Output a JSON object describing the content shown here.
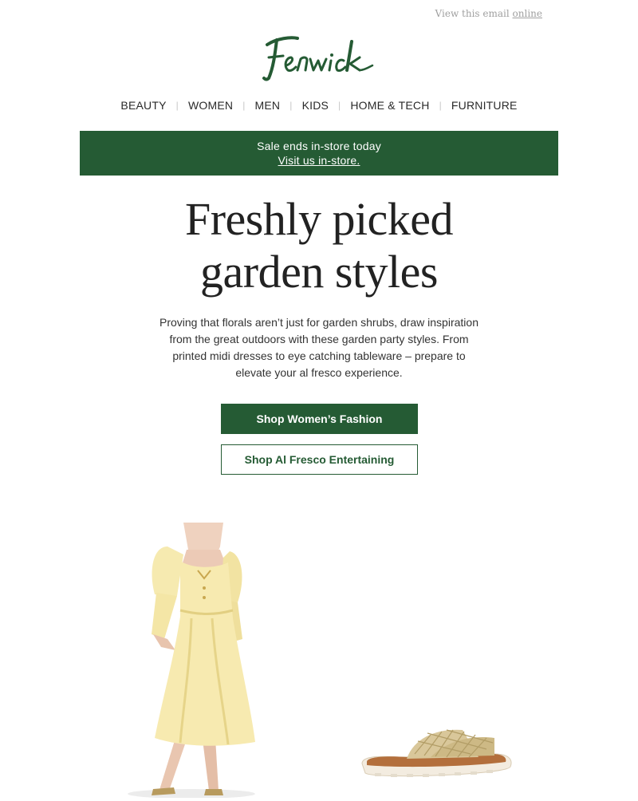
{
  "topbar": {
    "prefix": "View this email",
    "link": "online"
  },
  "brand": {
    "logo_alt": "Fenwick",
    "color": "#255b34"
  },
  "nav": {
    "items": [
      "BEAUTY",
      "WOMEN",
      "MEN",
      "KIDS",
      "HOME & TECH",
      "FURNITURE"
    ]
  },
  "banner": {
    "line1": "Sale ends in-store today",
    "link": "Visit us in-store."
  },
  "headline": {
    "line1": "Freshly picked",
    "line2": "garden styles"
  },
  "intro": "Proving that florals aren’t just for garden shrubs, draw inspiration from the great outdoors with these garden party styles. From printed midi dresses to eye catching tableware – prepare to elevate your al fresco experience.",
  "buttons": {
    "primary": "Shop Women’s Fashion",
    "secondary": "Shop Al Fresco Entertaining"
  },
  "products": [
    {
      "icon": "yellow-dress-image"
    },
    {
      "icon": "woven-sandal-image"
    }
  ]
}
